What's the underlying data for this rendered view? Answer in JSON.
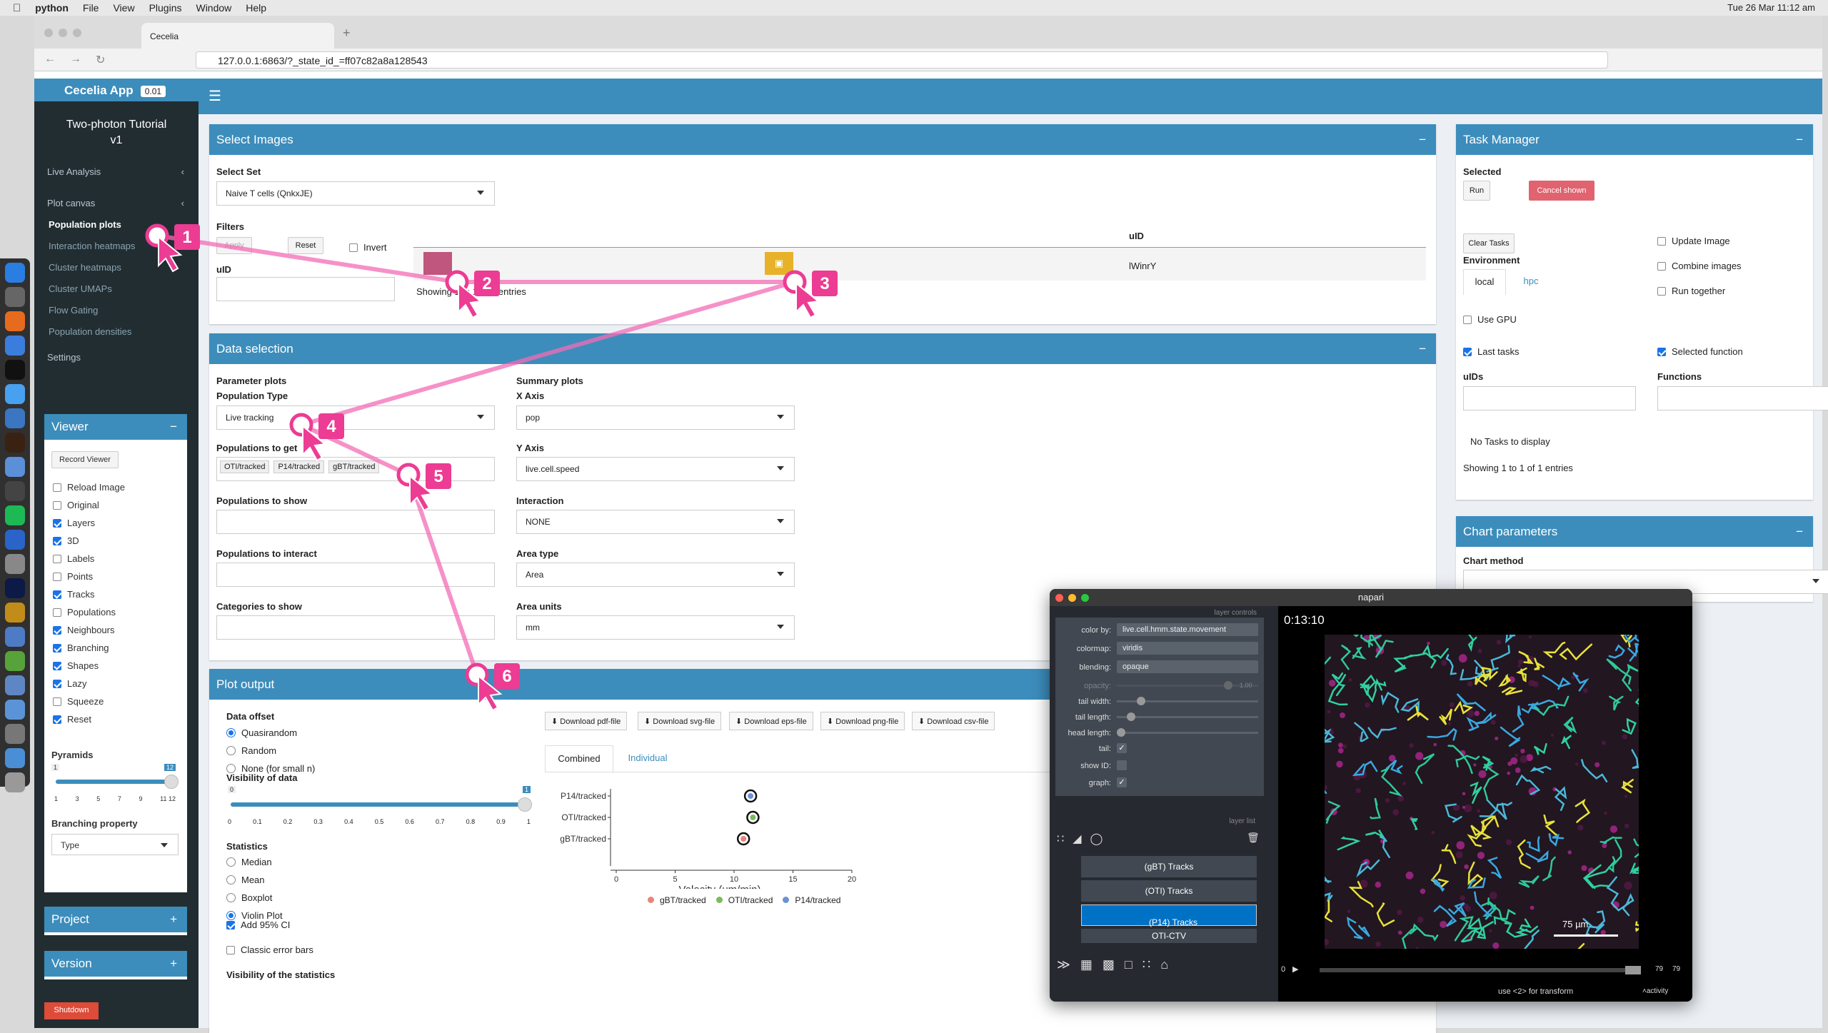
{
  "menubar": {
    "app": "python",
    "items": [
      "File",
      "View",
      "Plugins",
      "Window",
      "Help"
    ],
    "clock": "Tue 26 Mar  11:12 am"
  },
  "browser": {
    "tab_title": "Cecelia",
    "url": "127.0.0.1:6863/?_state_id_=ff07c82a8a128543"
  },
  "sidebar": {
    "brand": "Cecelia App",
    "version": "0.01",
    "project": "Two-photon Tutorial v1",
    "items": [
      {
        "label": "Live Analysis"
      },
      {
        "label": "Plot canvas"
      }
    ],
    "subitems": [
      "Population plots",
      "Interaction heatmaps",
      "Cluster heatmaps",
      "Cluster UMAPs",
      "Flow Gating",
      "Population densities"
    ],
    "settings": "Settings",
    "viewer": {
      "title": "Viewer",
      "record_button": "Record Viewer",
      "options": [
        {
          "label": "Reload Image",
          "checked": false
        },
        {
          "label": "Original",
          "checked": false
        },
        {
          "label": "Layers",
          "checked": true
        },
        {
          "label": "3D",
          "checked": true
        },
        {
          "label": "Labels",
          "checked": false
        },
        {
          "label": "Points",
          "checked": false
        },
        {
          "label": "Tracks",
          "checked": true
        },
        {
          "label": "Populations",
          "checked": false
        },
        {
          "label": "Neighbours",
          "checked": true
        },
        {
          "label": "Branching",
          "checked": true
        },
        {
          "label": "Shapes",
          "checked": true
        },
        {
          "label": "Lazy",
          "checked": true
        },
        {
          "label": "Squeeze",
          "checked": false
        },
        {
          "label": "Reset",
          "checked": true
        }
      ],
      "pyramids_label": "Pyramids",
      "pyramids_min": "1",
      "pyramids_value": "12",
      "pyramids_ticks": [
        "1",
        "3",
        "5",
        "7",
        "9",
        "11 12"
      ],
      "branching_label": "Branching property",
      "branching_value": "Type"
    },
    "project_box": "Project",
    "version_box": "Version",
    "shutdown": "Shutdown"
  },
  "select_images": {
    "title": "Select Images",
    "select_set_label": "Select Set",
    "select_set_value": "Naive T cells (QnkxJE)",
    "filters": "Filters",
    "apply": "Apply",
    "reset": "Reset",
    "invert": "Invert",
    "uid_label": "uID",
    "table_header_uid": "uID",
    "row_uid": "lWinrY",
    "showing": "Showing 1 to 1 of 1 entries"
  },
  "data_selection": {
    "title": "Data selection",
    "param_plots": "Parameter plots",
    "population_type_label": "Population Type",
    "population_type": "Live tracking",
    "pops_to_get_label": "Populations to get",
    "pops_to_get": [
      "OTI/tracked",
      "P14/tracked",
      "gBT/tracked"
    ],
    "pops_to_show": "Populations to show",
    "pops_to_interact": "Populations to interact",
    "categories_to_show": "Categories to show",
    "summary_plots": "Summary plots",
    "x_axis_label": "X Axis",
    "x_axis": "pop",
    "y_axis_label": "Y Axis",
    "y_axis": "live.cell.speed",
    "interaction_label": "Interaction",
    "interaction": "NONE",
    "area_type_label": "Area type",
    "area_type": "Area",
    "area_units_label": "Area units",
    "area_units": "mm"
  },
  "plot_output": {
    "title": "Plot output",
    "data_offset": "Data offset",
    "offsets": [
      {
        "label": "Quasirandom",
        "on": true
      },
      {
        "label": "Random",
        "on": false
      },
      {
        "label": "None (for small n)",
        "on": false
      }
    ],
    "visibility": "Visibility of data",
    "vis_min": "0",
    "vis_max": "1",
    "vis_ticks": [
      "0",
      "0.1",
      "0.2",
      "0.3",
      "0.4",
      "0.5",
      "0.6",
      "0.7",
      "0.8",
      "0.9",
      "1"
    ],
    "statistics": "Statistics",
    "stats": [
      {
        "label": "Median",
        "on": false
      },
      {
        "label": "Mean",
        "on": false
      },
      {
        "label": "Boxplot",
        "on": false
      },
      {
        "label": "Violin Plot",
        "on": true
      }
    ],
    "add_ci": "Add 95% CI",
    "classic": "Classic error bars",
    "vis_stats": "Visibility of the statistics",
    "downloads": [
      "Download pdf-file",
      "Download svg-file",
      "Download eps-file",
      "Download png-file",
      "Download csv-file"
    ],
    "tabs": [
      "Combined",
      "Individual"
    ]
  },
  "chart_data": {
    "type": "scatter",
    "categories": [
      "P14/tracked",
      "OTI/tracked",
      "gBT/tracked"
    ],
    "values": [
      11.4,
      11.6,
      10.8
    ],
    "xlabel": "Velocity (um/min)",
    "xlim": [
      0,
      20
    ],
    "xticks": [
      "0",
      "5",
      "10",
      "15",
      "20"
    ],
    "legend": [
      "gBT/tracked",
      "OTI/tracked",
      "P14/tracked"
    ],
    "colors": [
      "#e7847a",
      "#7cba5b",
      "#6a93d4"
    ]
  },
  "task_manager": {
    "title": "Task Manager",
    "selected": "Selected",
    "run": "Run",
    "cancel": "Cancel shown",
    "clear": "Clear Tasks",
    "environment": "Environment",
    "env_tabs": [
      "local",
      "hpc"
    ],
    "use_gpu": "Use GPU",
    "last_tasks": "Last tasks",
    "selected_function": "Selected function",
    "uids": "uIDs",
    "functions": "Functions",
    "no_tasks": "No Tasks to display",
    "showing": "Showing 1 to 1 of 1 entries",
    "update_image": "Update Image",
    "combine_images": "Combine images",
    "run_together": "Run together"
  },
  "chart_params": {
    "title": "Chart parameters",
    "chart_method": "Chart method"
  },
  "napari": {
    "title": "napari",
    "layer_controls": "layer controls",
    "layer_list": "layer list",
    "color_by": "live.cell.hmm.state.movement",
    "colormap": "viridis",
    "blending": "opaque",
    "opacity_val": "1.00",
    "labels": [
      "color by:",
      "colormap:",
      "blending:",
      "opacity:",
      "tail width:",
      "tail length:",
      "head length:",
      "tail:",
      "show ID:",
      "graph:"
    ],
    "layers": [
      "(gBT) Tracks",
      "(OTI) Tracks",
      "(P14) Tracks",
      "OTI-CTV"
    ],
    "time": "0:13:10",
    "scale": "75 µm",
    "frame_start": "0",
    "frame_a": "79",
    "frame_b": "79",
    "status": "use <2> for transform",
    "activity": "activity"
  },
  "annotations": [
    "1",
    "2",
    "3",
    "4",
    "5",
    "6"
  ]
}
